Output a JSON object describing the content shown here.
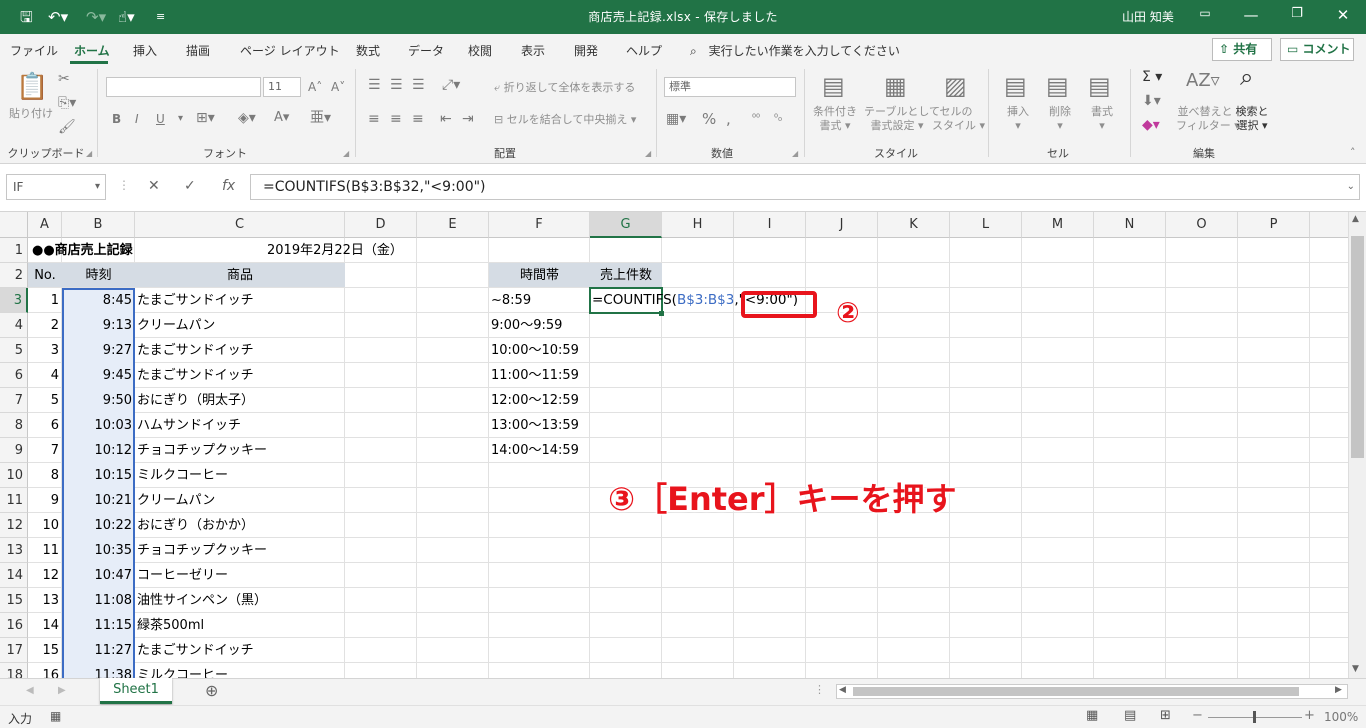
{
  "titlebar": {
    "title": "商店売上記録.xlsx  -  保存しました",
    "user": "山田 知美",
    "save_icon": "save-icon",
    "undo_icon": "undo-icon",
    "redo_icon": "redo-icon",
    "touch_icon": "touch-mode-icon",
    "customize_icon": "customize-qat-icon"
  },
  "tabs": [
    "ファイル",
    "ホーム",
    "挿入",
    "描画",
    "ページ レイアウト",
    "数式",
    "データ",
    "校閲",
    "表示",
    "開発",
    "ヘルプ"
  ],
  "tell_me": "実行したい作業を入力してください",
  "share_label": "共有",
  "comment_label": "コメント",
  "ribbon": {
    "clipboard": {
      "paste": "貼り付け",
      "label": "クリップボード"
    },
    "font": {
      "name": "",
      "size": "11",
      "label": "フォント",
      "bold": "B",
      "italic": "I",
      "underline": "U"
    },
    "alignment": {
      "wrap": "折り返して全体を表示する",
      "merge": "セルを結合して中央揃え",
      "label": "配置"
    },
    "number": {
      "format": "標準",
      "label": "数値"
    },
    "styles": {
      "conditional": [
        "条件付き",
        "書式"
      ],
      "table": [
        "テーブルとして",
        "書式設定"
      ],
      "cell": [
        "セルの",
        "スタイル"
      ],
      "label": "スタイル"
    },
    "cells": {
      "insert": "挿入",
      "delete": "削除",
      "format": "書式",
      "label": "セル"
    },
    "editing": {
      "sort": [
        "並べ替えと",
        "フィルター"
      ],
      "find": [
        "検索と",
        "選択"
      ],
      "label": "編集"
    }
  },
  "formula_bar": {
    "name_box": "IF",
    "formula": "=COUNTIFS(B$3:B$32,\"<9:00\")"
  },
  "columns": [
    "A",
    "B",
    "C",
    "D",
    "E",
    "F",
    "G",
    "H",
    "I",
    "J",
    "K",
    "L",
    "M",
    "N",
    "O",
    "P"
  ],
  "rows": [
    "1",
    "2",
    "3",
    "4",
    "5",
    "6",
    "7",
    "8",
    "9",
    "10",
    "11",
    "12",
    "13",
    "14",
    "15",
    "16",
    "17",
    "18"
  ],
  "sheet": {
    "title": "●●商店売上記録",
    "date": "2019年2月22日（金）",
    "headers": {
      "no": "No.",
      "time": "時刻",
      "product": "商品",
      "slot": "時間帯",
      "count": "売上件数"
    },
    "data": [
      {
        "no": "1",
        "time": "8:45",
        "product": "たまごサンドイッチ"
      },
      {
        "no": "2",
        "time": "9:13",
        "product": "クリームパン"
      },
      {
        "no": "3",
        "time": "9:27",
        "product": "たまごサンドイッチ"
      },
      {
        "no": "4",
        "time": "9:45",
        "product": "たまごサンドイッチ"
      },
      {
        "no": "5",
        "time": "9:50",
        "product": "おにぎり（明太子）"
      },
      {
        "no": "6",
        "time": "10:03",
        "product": "ハムサンドイッチ"
      },
      {
        "no": "7",
        "time": "10:12",
        "product": "チョコチップクッキー"
      },
      {
        "no": "8",
        "time": "10:15",
        "product": "ミルクコーヒー"
      },
      {
        "no": "9",
        "time": "10:21",
        "product": "クリームパン"
      },
      {
        "no": "10",
        "time": "10:22",
        "product": "おにぎり（おかか）"
      },
      {
        "no": "11",
        "time": "10:35",
        "product": "チョコチップクッキー"
      },
      {
        "no": "12",
        "time": "10:47",
        "product": "コーヒーゼリー"
      },
      {
        "no": "13",
        "time": "11:08",
        "product": "油性サインペン（黒）"
      },
      {
        "no": "14",
        "time": "11:15",
        "product": "緑茶500ml"
      },
      {
        "no": "15",
        "time": "11:27",
        "product": "たまごサンドイッチ"
      },
      {
        "no": "16",
        "time": "11:38",
        "product": "ミルクコーヒー"
      }
    ],
    "slots": [
      "~8:59",
      "9:00～9:59",
      "10:00～10:59",
      "11:00～11:59",
      "12:00～12:59",
      "13:00～13:59",
      "14:00～14:59"
    ],
    "editing": {
      "prefix": "=COUNTIFS(",
      "ref": "B$3:B$3",
      "suffix": ",\"<9:00\")"
    }
  },
  "annotations": {
    "step2": "②",
    "step3": "③［Enter］キーを押す"
  },
  "sheet_tab": "Sheet1",
  "status": {
    "mode": "入力",
    "zoom": "100%"
  },
  "colors": {
    "excel_green": "#217346",
    "header_fill": "#d5dce4",
    "ref_blue": "#3c6cc4",
    "annotation_red": "#e8141c"
  }
}
